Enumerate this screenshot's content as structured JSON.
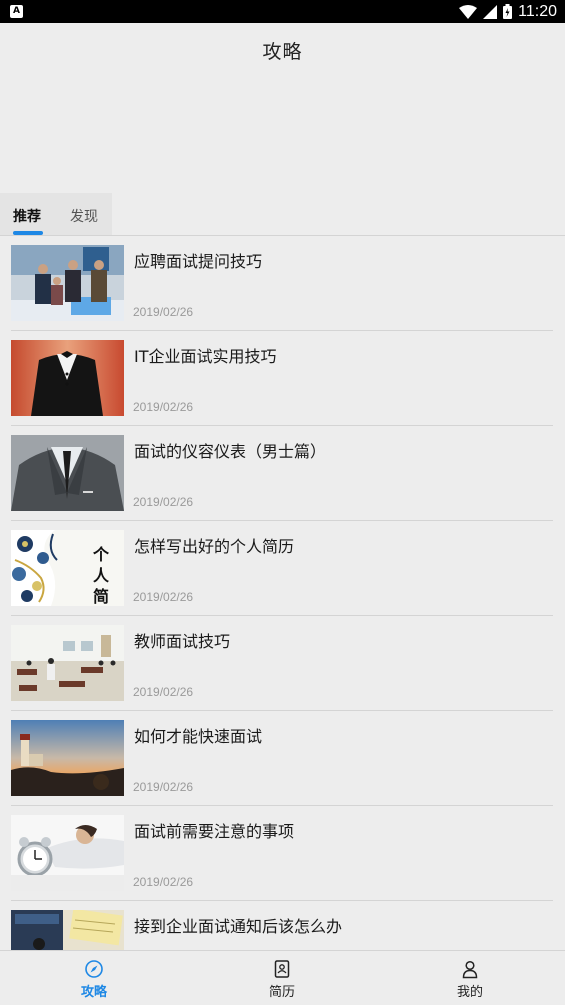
{
  "status_bar": {
    "app_badge": "A",
    "time": "11:20"
  },
  "header": {
    "title": "攻略"
  },
  "tabs": [
    {
      "label": "推荐",
      "active": true
    },
    {
      "label": "发现",
      "active": false
    }
  ],
  "articles": [
    {
      "title": "应聘面试提问技巧",
      "date": "2019/02/26",
      "thumb": "office-meeting"
    },
    {
      "title": "IT企业面试实用技巧",
      "date": "2019/02/26",
      "thumb": "tuxedo"
    },
    {
      "title": "面试的仪容仪表（男士篇）",
      "date": "2019/02/26",
      "thumb": "suit"
    },
    {
      "title": "怎样写出好的个人简历",
      "date": "2019/02/26",
      "thumb": "resume-card",
      "thumb_text": [
        "个",
        "人",
        "简"
      ]
    },
    {
      "title": "教师面试技巧",
      "date": "2019/02/26",
      "thumb": "classroom"
    },
    {
      "title": "如何才能快速面试",
      "date": "2019/02/26",
      "thumb": "lighthouse"
    },
    {
      "title": "面试前需要注意的事项",
      "date": "2019/02/26",
      "thumb": "alarm-clock"
    },
    {
      "title": "接到企业面试通知后该怎么办",
      "date": "",
      "thumb": "documents"
    }
  ],
  "bottom_nav": [
    {
      "label": "攻略",
      "icon": "compass-icon",
      "active": true
    },
    {
      "label": "简历",
      "icon": "resume-icon",
      "active": false
    },
    {
      "label": "我的",
      "icon": "person-icon",
      "active": false
    }
  ],
  "colors": {
    "accent": "#1e88e5",
    "background": "#ededed",
    "divider": "#d4d4d4"
  }
}
